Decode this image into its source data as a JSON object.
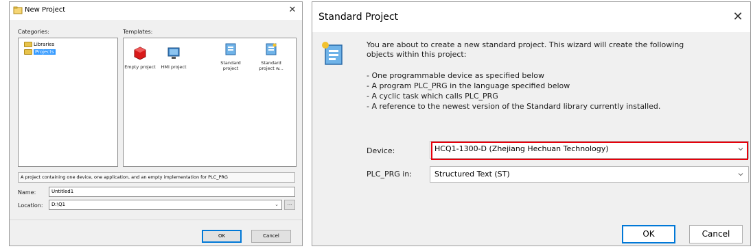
{
  "new_project": {
    "title": "New Project",
    "categories_label": "Categories:",
    "templates_label": "Templates:",
    "categories": [
      {
        "label": "Libraries",
        "selected": false
      },
      {
        "label": "Projects",
        "selected": true
      }
    ],
    "templates": [
      {
        "label": "Empty project",
        "icon": "empty-project-icon"
      },
      {
        "label": "HMI project",
        "icon": "hmi-project-icon"
      },
      {
        "label": "Standard project",
        "icon": "standard-project-icon"
      },
      {
        "label": "Standard project w...",
        "icon": "standard-project-with-application-icon"
      }
    ],
    "description": "A project containing one device, one application, and an empty implementation for PLC_PRG",
    "name_label": "Name:",
    "name_value": "Untitled1",
    "location_label": "Location:",
    "location_value": "D:\\Q1",
    "browse_label": "...",
    "ok_label": "OK",
    "cancel_label": "Cancel"
  },
  "standard_project": {
    "title": "Standard Project",
    "intro_line1": "You are about to create a new standard project. This wizard will create the following",
    "intro_line2": "objects within this project:",
    "bullets": [
      "- One programmable device as specified below",
      "- A program PLC_PRG in the language specified below",
      "- A cyclic task which calls PLC_PRG",
      "- A reference to the newest version of the Standard library currently installed."
    ],
    "device_label": "Device:",
    "device_value": "HCQ1-1300-D (Zhejiang Hechuan Technology)",
    "plc_prg_label": "PLC_PRG in:",
    "plc_prg_value": "Structured Text (ST)",
    "ok_label": "OK",
    "cancel_label": "Cancel",
    "highlight_color": "#e8000b"
  }
}
